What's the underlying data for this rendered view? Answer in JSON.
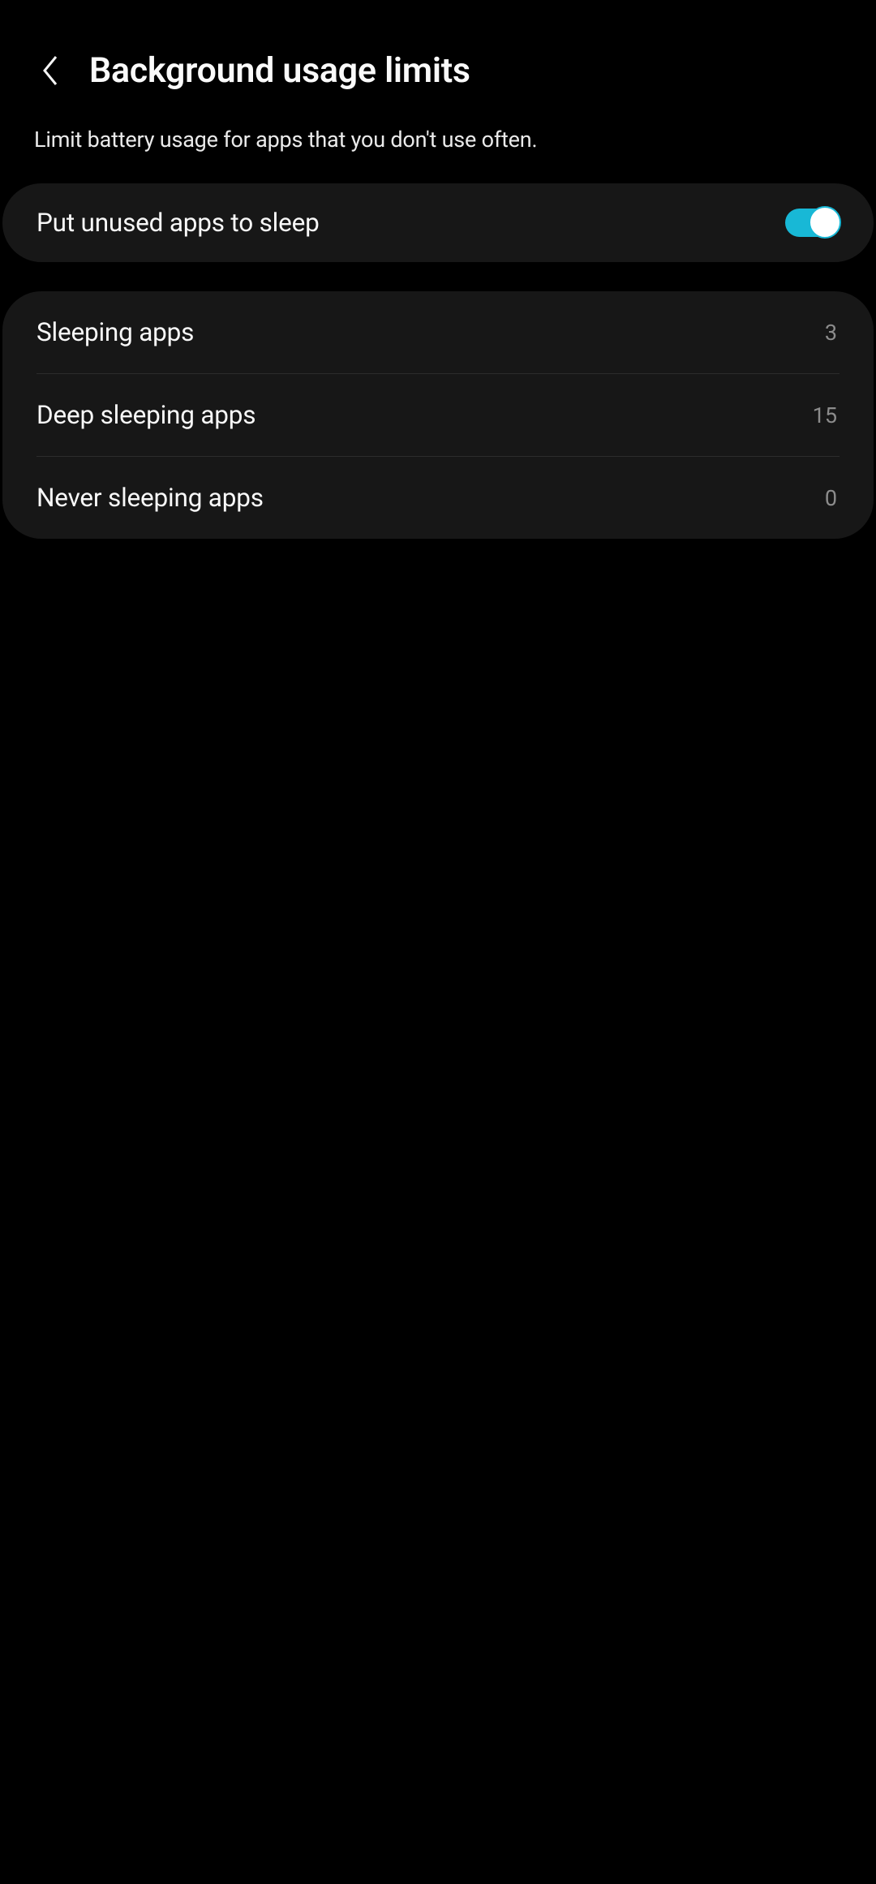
{
  "header": {
    "title": "Background usage limits"
  },
  "subtitle": "Limit battery usage for apps that you don't use often.",
  "section1": {
    "put_unused_label": "Put unused apps to sleep",
    "toggle_on": true
  },
  "section2": {
    "items": [
      {
        "label": "Sleeping apps",
        "value": "3"
      },
      {
        "label": "Deep sleeping apps",
        "value": "15"
      },
      {
        "label": "Never sleeping apps",
        "value": "0"
      }
    ]
  }
}
